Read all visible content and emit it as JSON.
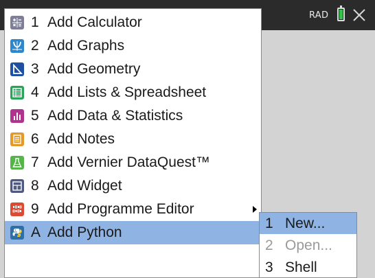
{
  "status": {
    "angle_mode": "RAD",
    "battery_color": "#35c24c",
    "close_icon": "close-x-icon"
  },
  "menu": {
    "items": [
      {
        "num": "1",
        "label": "Add Calculator",
        "icon": "calculator-icon",
        "color": "#7e7e96"
      },
      {
        "num": "2",
        "label": "Add Graphs",
        "icon": "graphs-icon",
        "color": "#2f87c9"
      },
      {
        "num": "3",
        "label": "Add Geometry",
        "icon": "geometry-icon",
        "color": "#1f4fa0"
      },
      {
        "num": "4",
        "label": "Add Lists & Spreadsheet",
        "icon": "spreadsheet-icon",
        "color": "#2aa45a"
      },
      {
        "num": "5",
        "label": "Add Data & Statistics",
        "icon": "data-statistics-icon",
        "color": "#b0338e"
      },
      {
        "num": "6",
        "label": "Add Notes",
        "icon": "notes-icon",
        "color": "#e49a27"
      },
      {
        "num": "7",
        "label": "Add Vernier DataQuest™",
        "icon": "vernier-dataquest-icon",
        "color": "#56b548"
      },
      {
        "num": "8",
        "label": "Add Widget",
        "icon": "widget-icon",
        "color": "#505a80"
      },
      {
        "num": "9",
        "label": "Add Programme Editor",
        "icon": "programme-editor-icon",
        "color": "#dd4a34"
      },
      {
        "num": "A",
        "label": "Add Python",
        "icon": "python-icon",
        "color": "#2f6fa5"
      }
    ],
    "selected_index": 9
  },
  "submenu": {
    "items": [
      {
        "num": "1",
        "label": "New...",
        "enabled": true
      },
      {
        "num": "2",
        "label": "Open...",
        "enabled": false
      },
      {
        "num": "3",
        "label": "Shell",
        "enabled": true
      }
    ]
  },
  "colors": {
    "topbar": "#2b2b2b",
    "canvas": "#d3d3d3",
    "selection": "#8fb3e2"
  }
}
